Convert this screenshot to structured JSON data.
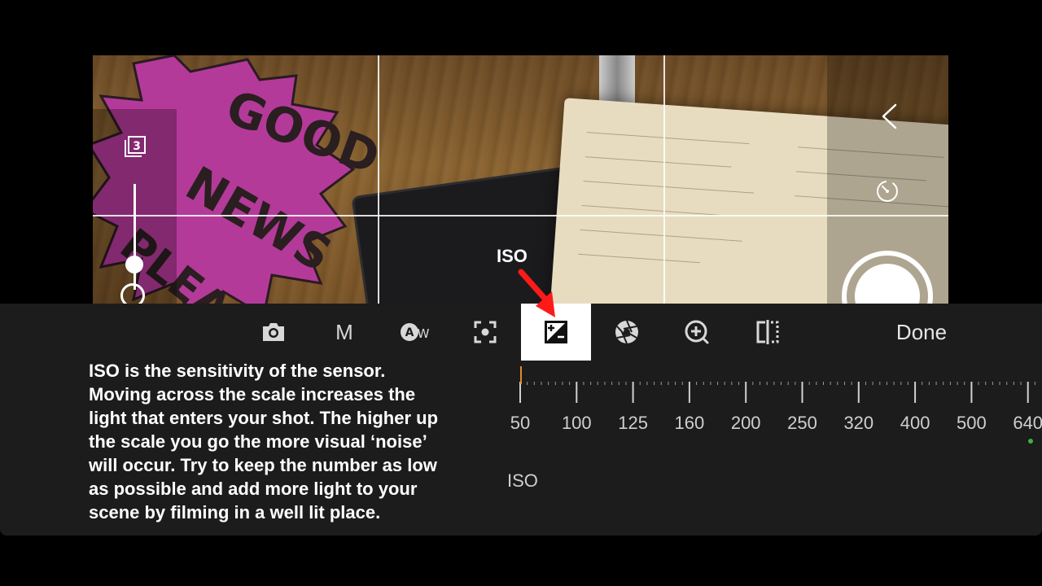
{
  "viewfinder": {
    "sign_text": [
      "GOOD",
      "NEWS",
      "PLEASE"
    ],
    "lens_badge": "3"
  },
  "toolbar": {
    "tools": [
      {
        "name": "camera-icon"
      },
      {
        "name": "manual-mode",
        "label": "M"
      },
      {
        "name": "auto-white-balance-icon",
        "label": "AW"
      },
      {
        "name": "focus-icon"
      },
      {
        "name": "exposure-icon",
        "active": true
      },
      {
        "name": "aperture-icon"
      },
      {
        "name": "zoom-in-icon"
      },
      {
        "name": "compare-icon"
      }
    ],
    "done_label": "Done"
  },
  "callout": {
    "label": "ISO",
    "arrow_color": "#ff1a1a"
  },
  "explanation": "ISO is the sensitivity of the sensor. Moving across the scale increases the light that enters your shot. The higher up the scale you go the more visual ‘noise’ will occur. Try to keep the number as low as possible and add more light to your scene by filming in a well lit place.",
  "iso_scale": {
    "values": [
      "50",
      "100",
      "125",
      "160",
      "200",
      "250",
      "320",
      "400",
      "500",
      "640"
    ],
    "selected": "50",
    "marker_color": "#e08a2a",
    "indicator_color": "#3fae4a"
  },
  "mode_label": "ISO",
  "colors": {
    "panel_bg": "#1c1c1c",
    "background": "#000000",
    "active_tool_bg": "#ffffff"
  }
}
